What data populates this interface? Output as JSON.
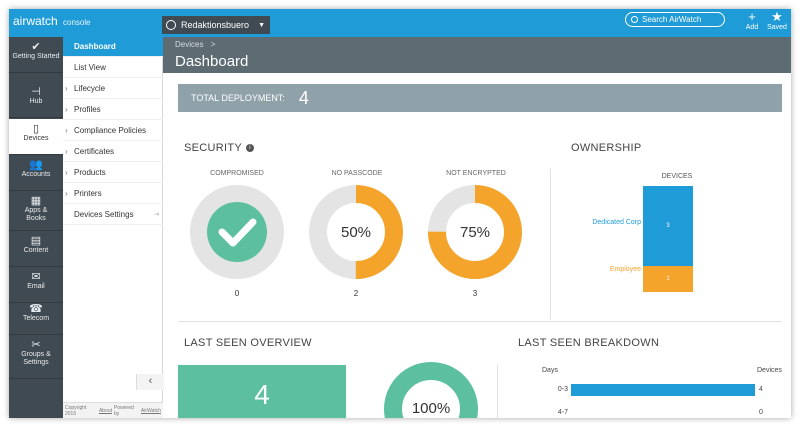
{
  "topbar": {
    "logo": "airwatch",
    "logo_sub": "console",
    "org": "Redaktionsbuero",
    "search_placeholder": "Search AirWatch",
    "add_label": "Add",
    "saved_label": "Saved"
  },
  "leftnav": [
    {
      "label": "Getting Started",
      "icon": "check-icon"
    },
    {
      "label": "Hub",
      "icon": "hub-icon"
    },
    {
      "label": "Devices",
      "icon": "phone-icon"
    },
    {
      "label": "Accounts",
      "icon": "users-icon"
    },
    {
      "label": "Apps & Books",
      "icon": "grid-icon"
    },
    {
      "label": "Content",
      "icon": "document-icon"
    },
    {
      "label": "Email",
      "icon": "envelope-icon"
    },
    {
      "label": "Telecom",
      "icon": "telephone-icon"
    },
    {
      "label": "Groups & Settings",
      "icon": "tools-icon"
    }
  ],
  "submenu": [
    {
      "label": "Dashboard"
    },
    {
      "label": "List View"
    },
    {
      "label": "Lifecycle"
    },
    {
      "label": "Profiles"
    },
    {
      "label": "Compliance Policies"
    },
    {
      "label": "Certificates"
    },
    {
      "label": "Products"
    },
    {
      "label": "Printers"
    },
    {
      "label": "Devices Settings"
    }
  ],
  "footer": {
    "copyright": "Copyright 2015",
    "about": "About",
    "powered": "Powered by",
    "brand": "AirWatch"
  },
  "header": {
    "breadcrumb": "Devices",
    "breadcrumb_sep": ">",
    "title": "Dashboard"
  },
  "deployment": {
    "label": "TOTAL DEPLOYMENT:",
    "value": "4"
  },
  "security": {
    "title": "SECURITY",
    "info_glyph": "i",
    "items": [
      {
        "label": "COMPROMISED",
        "count": "0",
        "percent": 0
      },
      {
        "label": "NO PASSCODE",
        "count": "2",
        "value_text": "50%",
        "percent": 50
      },
      {
        "label": "NOT ENCRYPTED",
        "count": "3",
        "value_text": "75%",
        "percent": 75
      }
    ]
  },
  "ownership": {
    "title": "OWNERSHIP",
    "column_label": "DEVICES",
    "segments": [
      {
        "label": "Dedicated Corp",
        "value": "3",
        "count": 3,
        "color": "#1f9bd7"
      },
      {
        "label": "Employee",
        "value": "1",
        "count": 1,
        "color": "#f5a42b"
      }
    ]
  },
  "last_seen": {
    "title": "LAST SEEN OVERVIEW",
    "total": "4",
    "percent_text": "100%"
  },
  "breakdown": {
    "title": "LAST SEEN BREAKDOWN",
    "days_label": "Days",
    "devices_label": "Devices",
    "rows": [
      {
        "range": "0-3",
        "count": "4",
        "value": 4
      },
      {
        "range": "4-7",
        "count": "0",
        "value": 0
      }
    ]
  },
  "colors": {
    "accent": "#1f9bd7",
    "teal": "#5bbfa0",
    "orange": "#f5a42b",
    "ring": "#e4e4e4"
  }
}
